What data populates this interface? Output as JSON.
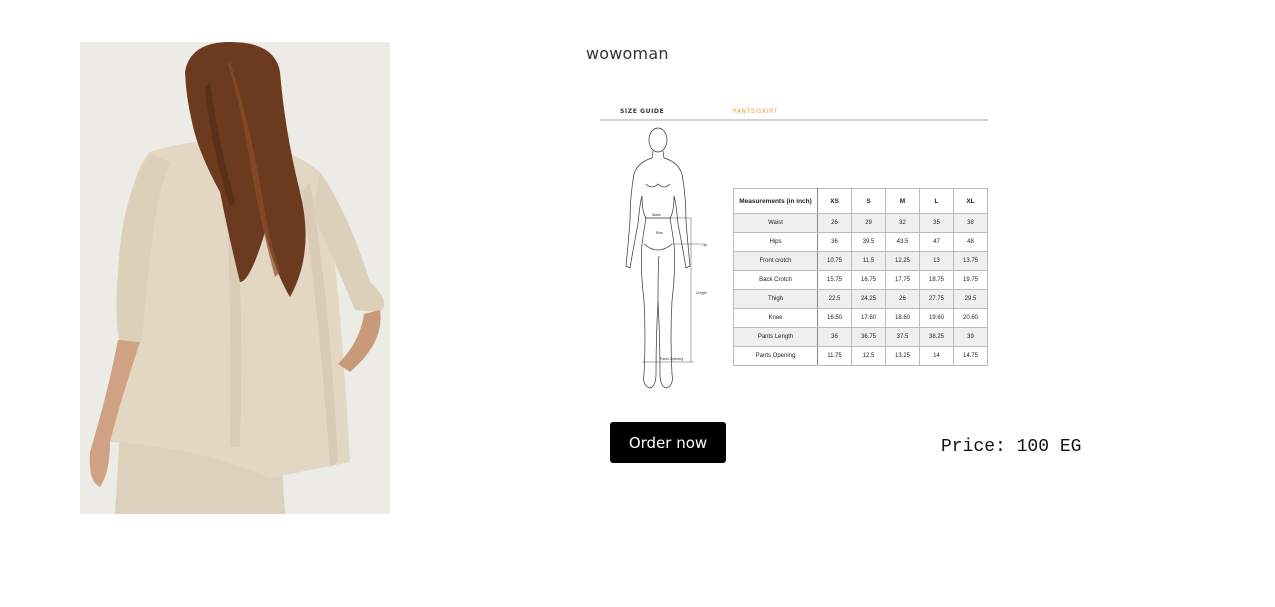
{
  "product": {
    "image_alt": "woman in beige linen blazer, back view",
    "brand": "wowoman",
    "price_text": "Price: 100 EG",
    "order_button_label": "Order now"
  },
  "size_guide": {
    "title": "SIZE GUIDE",
    "subtitle": "PANTS/SKIRT",
    "figure_labels": {
      "waist": "Waist",
      "rise": "Rise",
      "hip": "Hip",
      "length": "Length",
      "opening": "Pants Opening"
    },
    "header": [
      "Measurements (in inch)",
      "XS",
      "S",
      "M",
      "L",
      "XL"
    ],
    "rows": [
      [
        "Waist",
        "26",
        "29",
        "32",
        "35",
        "38"
      ],
      [
        "Hips",
        "36",
        "39.5",
        "43.5",
        "47",
        "48"
      ],
      [
        "Front crotch",
        "10.75",
        "11.5",
        "12.25",
        "13",
        "13.75"
      ],
      [
        "Back Crotch",
        "15.75",
        "16.75",
        "17.75",
        "18.75",
        "19.75"
      ],
      [
        "Thigh",
        "22.5",
        "24.25",
        "26",
        "27.75",
        "29.5"
      ],
      [
        "Knee",
        "16.50",
        "17.60",
        "18.60",
        "19.60",
        "20.60"
      ],
      [
        "Pants Length",
        "36",
        "36.75",
        "37.5",
        "38.25",
        "39"
      ],
      [
        "Pants Opening",
        "11.75",
        "12.5",
        "13.25",
        "14",
        "14.75"
      ]
    ]
  },
  "colors": {
    "button_bg": "#000000",
    "button_text": "#ffffff",
    "accent_orange": "#e8a040",
    "photo_bg": "#ecebe6",
    "blazer": "#e3d7c4",
    "hair": "#6b3a1f"
  }
}
